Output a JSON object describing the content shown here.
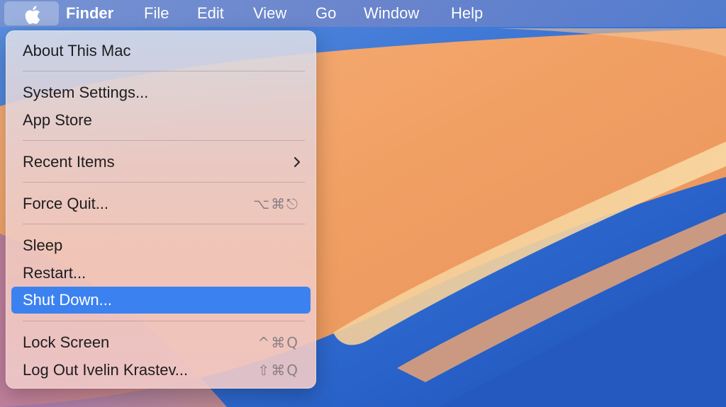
{
  "menubar": {
    "apple_icon": "apple-logo-icon",
    "titles": [
      "Finder",
      "File",
      "Edit",
      "View",
      "Go",
      "Window",
      "Help"
    ]
  },
  "apple_menu": {
    "items": [
      {
        "label": "About This Mac",
        "shortcut": ""
      },
      {
        "label": "System Settings...",
        "shortcut": ""
      },
      {
        "label": "App Store",
        "shortcut": ""
      },
      {
        "label": "Recent Items",
        "shortcut": "",
        "submenu_icon": "chevron-right-icon"
      },
      {
        "label": "Force Quit...",
        "shortcut": "⌥⌘⎋"
      },
      {
        "label": "Sleep",
        "shortcut": ""
      },
      {
        "label": "Restart...",
        "shortcut": ""
      },
      {
        "label": "Shut Down...",
        "shortcut": "",
        "highlighted": true
      },
      {
        "label": "Lock Screen",
        "shortcut": "^⌘Q"
      },
      {
        "label": "Log Out Ivelin Krastev...",
        "shortcut": "⇧⌘Q"
      }
    ]
  },
  "colors": {
    "highlight": "#3b82f0",
    "wallpaper_orange": "#f0a060",
    "wallpaper_blue": "#2f6fd0"
  }
}
